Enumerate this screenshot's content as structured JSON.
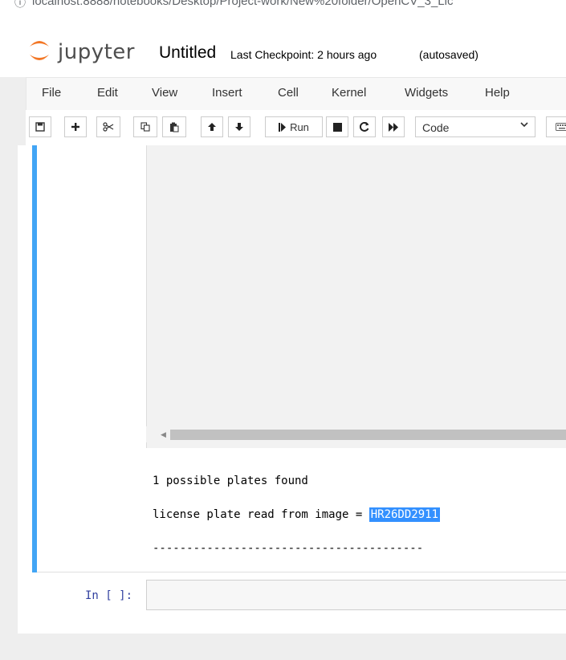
{
  "browser": {
    "url": "localhost:8888/notebooks/Desktop/Project-work/New%20folder/OpenCV_3_Lic"
  },
  "header": {
    "logo_text": "jupyter",
    "notebook_name": "Untitled",
    "checkpoint": "Last Checkpoint: 2 hours ago",
    "autosave_status": "(autosaved)"
  },
  "menubar": {
    "items": [
      "File",
      "Edit",
      "View",
      "Insert",
      "Cell",
      "Kernel",
      "Widgets",
      "Help"
    ]
  },
  "toolbar": {
    "run_label": "Run",
    "cell_type": "Code",
    "icons": [
      "save-icon",
      "plus-icon",
      "cut-icon",
      "copy-icon",
      "paste-icon",
      "arrow-up-icon",
      "arrow-down-icon",
      "run-icon",
      "stop-icon",
      "restart-icon",
      "fast-forward-icon",
      "chevron-down-icon",
      "keyboard-icon"
    ]
  },
  "output": {
    "line1": "1 possible plates found",
    "line2_prefix": "license plate read from image = ",
    "plate": "HR26DD2911",
    "separator": "----------------------------------------"
  },
  "input_cell": {
    "prompt": "In [ ]:"
  },
  "colors": {
    "cell_selected_bar": "#42a5f5",
    "selection_highlight": "#3390ff",
    "prompt_color": "#303f9f"
  }
}
